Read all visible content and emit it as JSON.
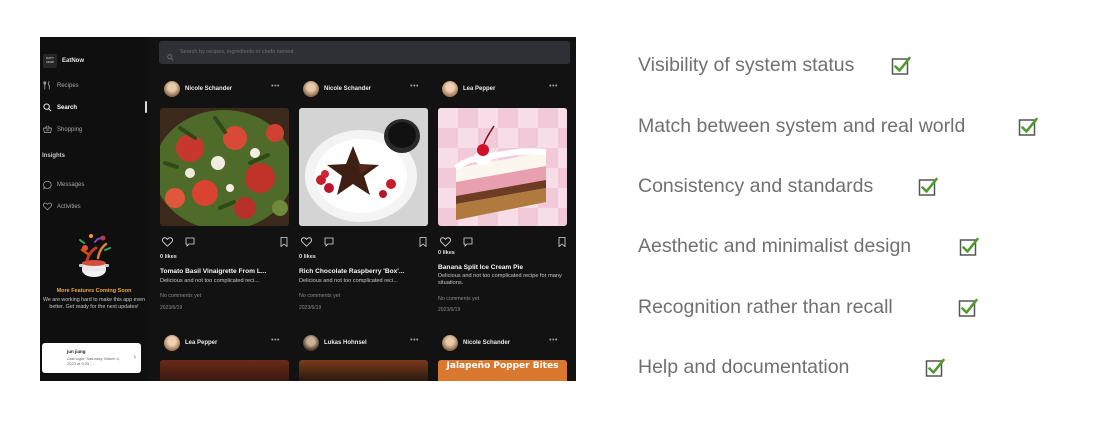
{
  "app": {
    "brand": {
      "logo_text": "EATY NOW",
      "name": "EatNow"
    },
    "nav": [
      {
        "label": "Recipes",
        "icon": "utensils-icon"
      },
      {
        "label": "Search",
        "icon": "search-icon",
        "active": true
      },
      {
        "label": "Shopping",
        "icon": "basket-icon"
      }
    ],
    "insights_label": "Insights",
    "insight_items": [
      {
        "label": "Messages",
        "icon": "message-bubble-icon"
      },
      {
        "label": "Activities",
        "icon": "heart-icon"
      }
    ],
    "promo": {
      "title": "More Features Coming Soon",
      "text": "We are working hard to make this app even better. Get ready for the next updates!"
    },
    "user": {
      "name": "jun jiang",
      "last_login": "Last login: Saturday, March 4, 2023 at 9:25 ..."
    },
    "search_placeholder": "Search by recipes, ingredients or chefs named",
    "posts": [
      {
        "author": "Nicole Schander",
        "likes": "0 likes",
        "title": "Tomato Basil Vinaigrette From L...",
        "description": "Delicious and not too complicated reci...",
        "comments": "No comments yet",
        "date": "2023/6/19"
      },
      {
        "author": "Nicole Schander",
        "likes": "0 likes",
        "title": "Rich Chocolate Raspberry 'Box'...",
        "description": "Delicious and not too complicated reci...",
        "comments": "No comments yet",
        "date": "2023/6/19"
      },
      {
        "author": "Lea Pepper",
        "likes": "0 likes",
        "title": "Banana Split Ice Cream Pie",
        "description": "Delicious and not too complicated recipe for many situations.",
        "comments": "No comments yet",
        "date": "2023/6/19"
      }
    ],
    "second_row_authors": [
      "Lea Pepper",
      "Lukas Hohnsel",
      "Nicole Schander"
    ],
    "partial_card_title": "Jalapeño Popper Bites"
  },
  "heuristics": [
    {
      "label": "Visibility of system status",
      "checked": true
    },
    {
      "label": "Match between system and real world",
      "checked": true
    },
    {
      "label": "Consistency and standards",
      "checked": true
    },
    {
      "label": "Aesthetic and minimalist design",
      "checked": true
    },
    {
      "label": "Recognition rather than recall",
      "checked": true
    },
    {
      "label": "Help and documentation",
      "checked": true
    }
  ],
  "colors": {
    "app_background": "#121212",
    "promo_accent": "#f0a83a",
    "check_green": "#4e9a2b",
    "heuristic_text": "#707070"
  }
}
